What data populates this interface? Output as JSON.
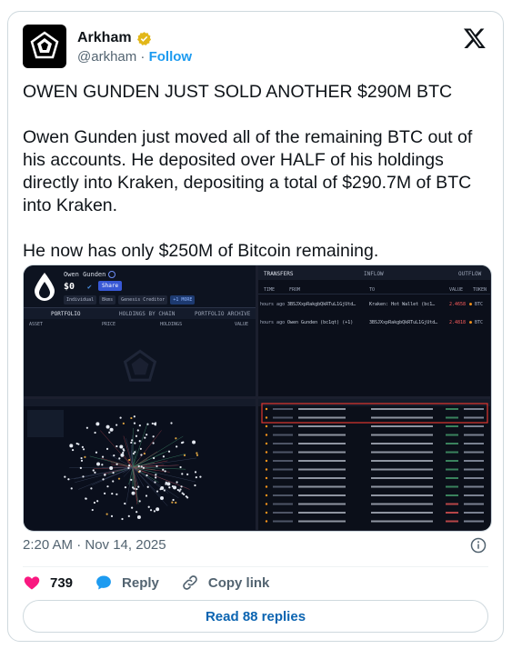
{
  "author": {
    "name": "Arkham",
    "handle": "@arkham",
    "separator": "·",
    "follow_label": "Follow"
  },
  "tweet": {
    "headline": "OWEN GUNDEN JUST SOLD ANOTHER $290M BTC",
    "paragraph1": "Owen Gunden just moved all of the remaining BTC out of his accounts. He deposited over HALF of his holdings directly into Kraken, depositing a total of $290.7M of BTC into Kraken.",
    "paragraph2": "He now has only $250M of Bitcoin remaining."
  },
  "media": {
    "panel1": {
      "entity_name": "Owen Gunden",
      "balance": "$0",
      "share_label": "Share",
      "tags": [
        "Individual",
        "Bkms",
        "Genesis Creditor",
        "+1 MORE"
      ],
      "tabs": [
        "PORTFOLIO",
        "HOLDINGS BY CHAIN",
        "PORTFOLIO ARCHIVE"
      ],
      "columns": [
        "ASSET",
        "PRICE",
        "HOLDINGS",
        "VALUE"
      ]
    },
    "panel2": {
      "tabs": [
        "TRANSFERS",
        "INFLOW",
        "OUTFLOW"
      ],
      "columns": [
        "TIME",
        "FROM",
        "TO",
        "VALUE",
        "TOKEN"
      ],
      "rows": [
        {
          "time": "hours ago",
          "from": "3BSJXxpRakgbQkRTuL1GjUtd…",
          "to": "Kraken: Hot Wallet (bc1…",
          "value": "2.4658",
          "token": "BTC"
        },
        {
          "time": "hours ago",
          "from": "Owen Gunden (bc1qt) (+1)",
          "to": "3BSJXxpRakgbQkRTuL1GjUtd…",
          "value": "2.4818",
          "token": "BTC"
        }
      ]
    }
  },
  "meta": {
    "timestamp": "2:20 AM · Nov 14, 2025"
  },
  "actions": {
    "likes": "739",
    "reply_label": "Reply",
    "copy_label": "Copy link"
  },
  "read_replies_label": "Read 88 replies",
  "colors": {
    "accent": "#1d9bf0",
    "like": "#f91880",
    "verified": "#e2b719",
    "highlight_red": "#e0362f"
  }
}
